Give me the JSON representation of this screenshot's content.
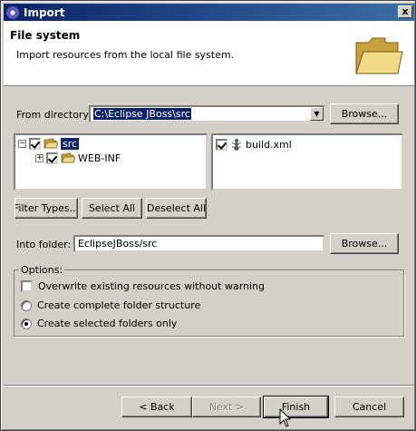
{
  "window": {
    "title": "Import",
    "close_glyph": "x",
    "app_icon": "eclipse-icon"
  },
  "header": {
    "title": "File system",
    "description": "Import resources from the local file system.",
    "icon": "folder-icon"
  },
  "from_directory": {
    "label": "From directory:",
    "value": "C:\\Eclipse JBoss\\src",
    "browse_label": "Browse..."
  },
  "folder_tree": [
    {
      "label": "src",
      "checked": true,
      "expanded": true,
      "selected": true
    },
    {
      "label": "WEB-INF",
      "checked": true,
      "expanded": false,
      "selected": false
    }
  ],
  "file_list": [
    {
      "label": "build.xml",
      "checked": true
    }
  ],
  "selection_buttons": {
    "filter_types": "Filter Types...",
    "select_all": "Select All",
    "deselect_all": "Deselect All"
  },
  "into_folder": {
    "label": "Into folder:",
    "value": "EclipseJBoss/src",
    "browse_label": "Browse..."
  },
  "options": {
    "title": "Options:",
    "overwrite": {
      "label": "Overwrite existing resources without warning",
      "checked": false
    },
    "complete_structure": {
      "label": "Create complete folder structure",
      "selected": false
    },
    "selected_only": {
      "label": "Create selected folders only",
      "selected": true
    }
  },
  "footer": {
    "back": "< Back",
    "next": "Next >",
    "finish": "Finish",
    "cancel": "Cancel"
  },
  "colors": {
    "selection": "#0a246a",
    "titlebar_start": "#0a246a",
    "dialog_bg": "#d4d0c8"
  }
}
